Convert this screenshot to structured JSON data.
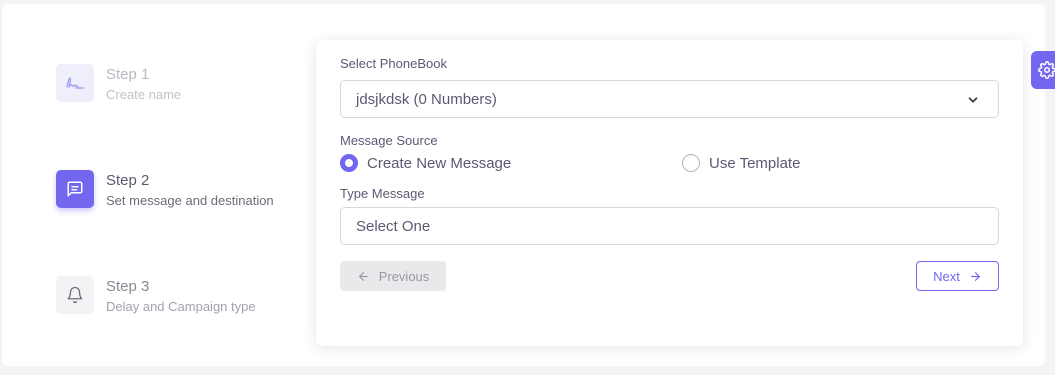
{
  "steps": [
    {
      "title": "Step 1",
      "subtitle": "Create name",
      "icon": "signature-icon",
      "state": "completed"
    },
    {
      "title": "Step 2",
      "subtitle": "Set message and destination",
      "icon": "message-square-icon",
      "state": "active"
    },
    {
      "title": "Step 3",
      "subtitle": "Delay and Campaign type",
      "icon": "bell-icon",
      "state": "upcoming"
    }
  ],
  "form": {
    "phonebook_label": "Select PhoneBook",
    "phonebook_value": "jdsjkdsk (0 Numbers)",
    "message_source_label": "Message Source",
    "radio_options": [
      {
        "label": "Create New Message",
        "selected": true
      },
      {
        "label": "Use Template",
        "selected": false
      }
    ],
    "type_message_label": "Type Message",
    "type_message_value": "Select One",
    "previous_label": "Previous",
    "next_label": "Next"
  },
  "colors": {
    "accent": "#7367f0",
    "text": "#5e5873",
    "muted": "#b9b9c3"
  }
}
